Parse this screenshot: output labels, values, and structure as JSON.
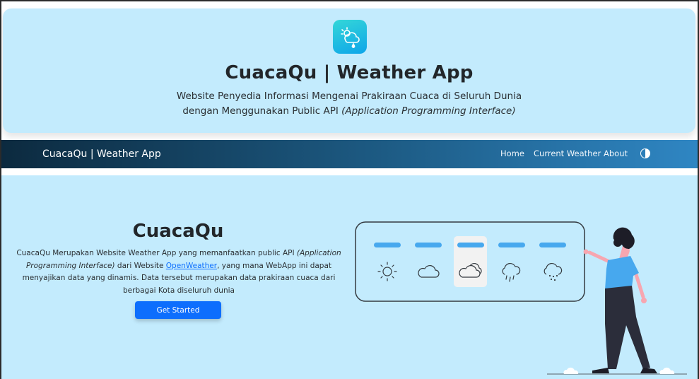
{
  "header": {
    "logo_icon": "cloud-sun-rain-icon",
    "title": "CuacaQu | Weather App",
    "subtitle_line1": "Website Penyedia Informasi Mengenai Prakiraan Cuaca di Seluruh Dunia",
    "subtitle_line2_prefix": "dengan Menggunakan Public API ",
    "subtitle_line2_italic": "(Application Programming Interface)"
  },
  "navbar": {
    "brand": "CuacaQu | Weather App",
    "links": [
      "Home",
      "Current Weather",
      "About"
    ],
    "theme_toggle_icon": "contrast-icon"
  },
  "hero": {
    "title": "CuacaQu",
    "desc_part1": "CuacaQu Merupakan Website Weather App yang memanfaatkan public API ",
    "desc_italic": "(Application Programming Interface)",
    "desc_part2": " dari Website ",
    "desc_link": "OpenWeather",
    "desc_part3": ", yang mana WebApp ini dapat menyajikan data yang dinamis. Data tersebut merupakan data prakiraan cuaca dari berbagai Kota diseluruh dunia",
    "cta_label": "Get Started"
  },
  "illustration": {
    "icons": [
      "sun-icon",
      "cloud-icon",
      "cloudy-icon",
      "rain-icon",
      "snow-icon"
    ],
    "selected_index": 2
  },
  "colors": {
    "background": "#c3ebfd",
    "primary": "#0d6efd",
    "accent_blue": "#47a8ee"
  }
}
